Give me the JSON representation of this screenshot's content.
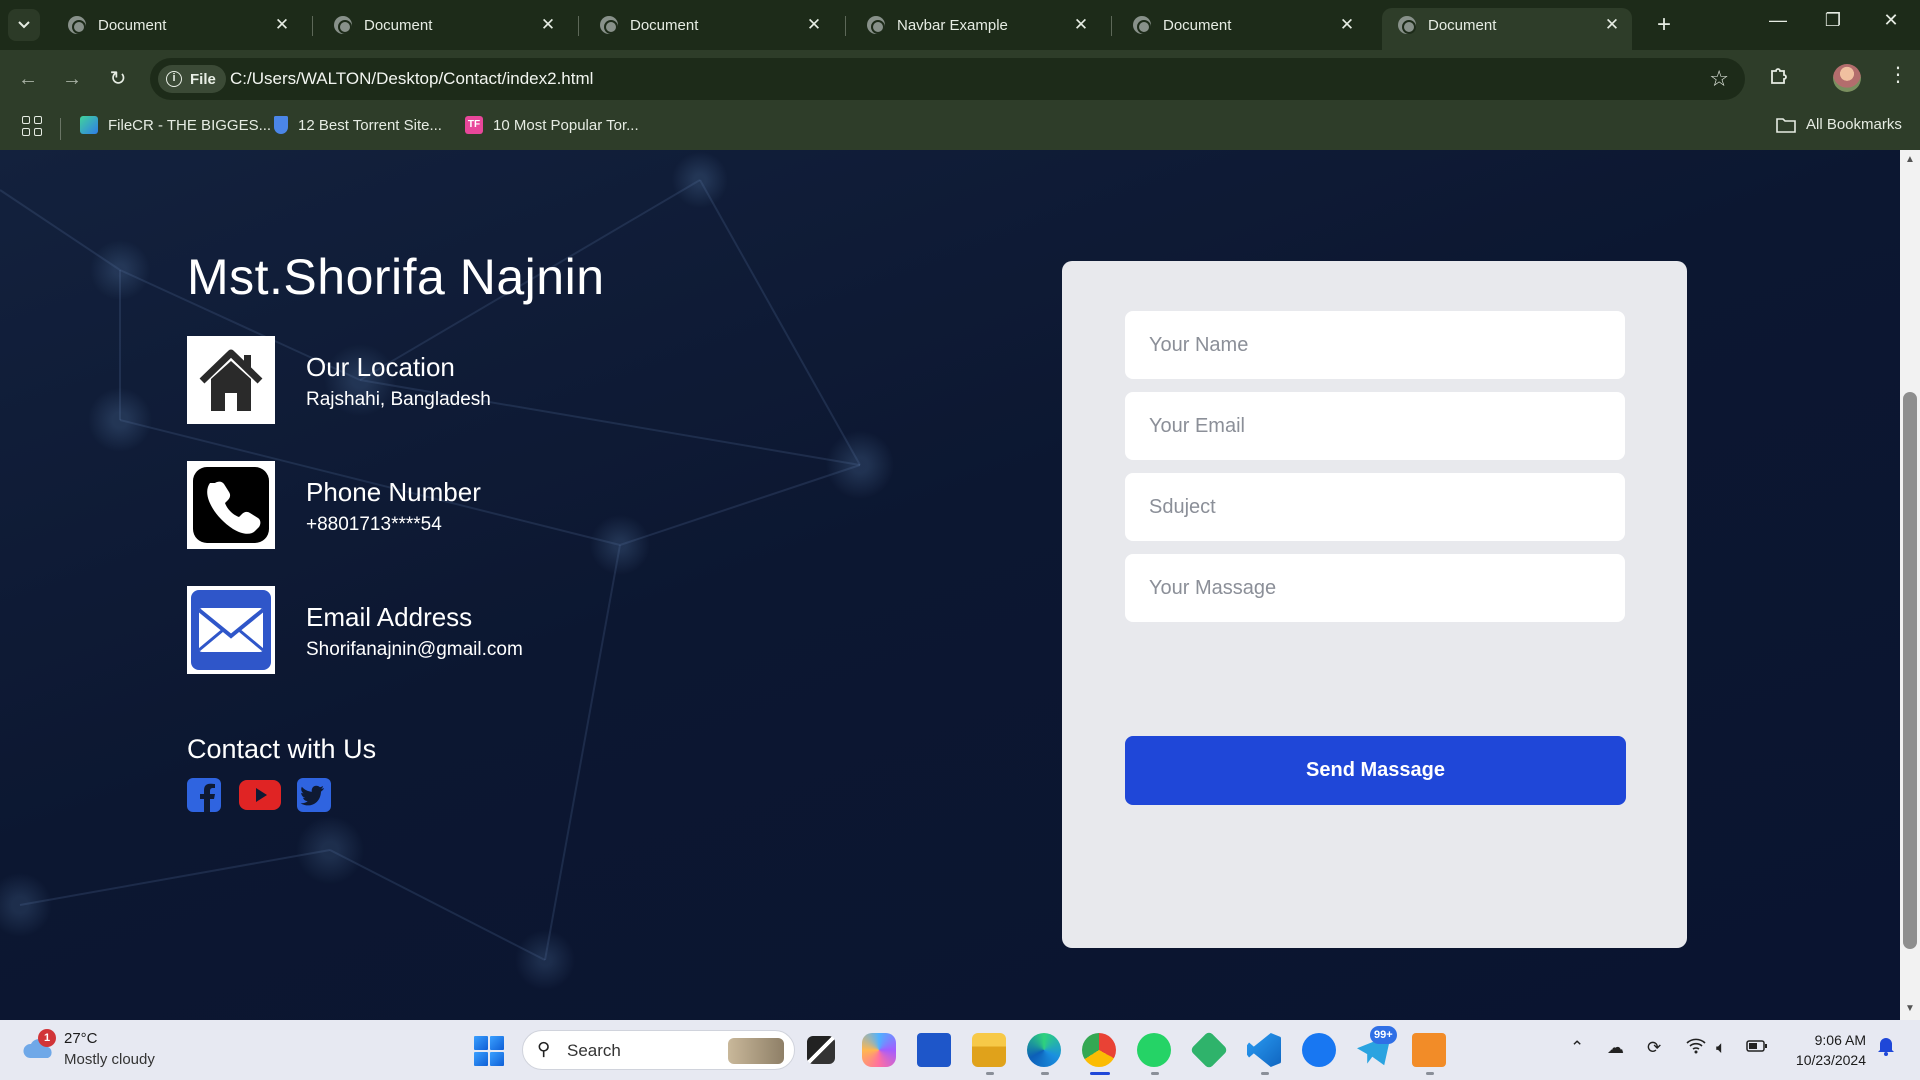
{
  "browser": {
    "tabs": [
      {
        "label": "Document",
        "active": false
      },
      {
        "label": "Document",
        "active": false
      },
      {
        "label": "Document",
        "active": false
      },
      {
        "label": "Navbar Example",
        "active": false
      },
      {
        "label": "Document",
        "active": false
      },
      {
        "label": "Document",
        "active": true
      }
    ],
    "address": {
      "scheme_chip": "File",
      "url": "C:/Users/WALTON/Desktop/Contact/index2.html"
    },
    "bookmarks": [
      {
        "label": "FileCR - THE BIGGES...",
        "color": "#3f8ef5"
      },
      {
        "label": "12 Best Torrent Site...",
        "color": "#4b86e8"
      },
      {
        "label": "10 Most Popular Tor...",
        "color": "#e8479a"
      }
    ],
    "all_bookmarks": "All Bookmarks"
  },
  "page": {
    "name": "Mst.Shorifa Najnin",
    "info": [
      {
        "title": "Our Location",
        "value": "Rajshahi, Bangladesh",
        "icon": "house-icon"
      },
      {
        "title": "Phone Number",
        "value": "+8801713****54",
        "icon": "phone-icon"
      },
      {
        "title": "Email Address",
        "value": "Shorifanajnin@gmail.com",
        "icon": "mail-icon"
      }
    ],
    "contact_title": "Contact with Us",
    "socials": [
      {
        "name": "facebook-icon",
        "color": "#2f64e0"
      },
      {
        "name": "youtube-icon",
        "color": "#e02424"
      },
      {
        "name": "twitter-icon",
        "color": "#2f64e0"
      }
    ],
    "form": {
      "name_placeholder": "Your Name",
      "email_placeholder": "Your Email",
      "subject_placeholder": "Sduject",
      "message_placeholder": "Your Massage",
      "submit_label": "Send Massage"
    }
  },
  "taskbar": {
    "weather": {
      "temp": "27°C",
      "desc": "Mostly cloudy",
      "alert_count": "1"
    },
    "search_label": "Search",
    "telegram_badge": "99+",
    "time": "9:06 AM",
    "date": "10/23/2024"
  },
  "colors": {
    "accent_button": "#1f47d8",
    "page_bg": "#0b1530",
    "card_bg": "#e8e9ed",
    "chrome": "#2e3d29"
  }
}
